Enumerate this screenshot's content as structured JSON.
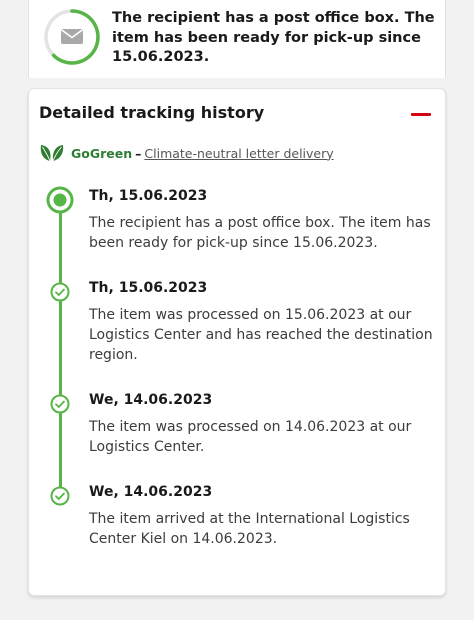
{
  "status": {
    "icon": "envelope-icon",
    "text": "The recipient has a post office box. The item has been ready for pick-up since 15.06.2023."
  },
  "history": {
    "title": "Detailed tracking history",
    "collapse_icon": "minus-icon",
    "gogreen": {
      "name": "GoGreen",
      "dash": "–",
      "link": "Climate-neutral letter delivery",
      "icon": "leaf-icon"
    },
    "events": [
      {
        "date": "Th, 15.06.2023",
        "text": "The recipient has a post office box. The item has been ready for pick-up since 15.06.2023.",
        "state": "current"
      },
      {
        "date": "Th, 15.06.2023",
        "text": "The item was processed on 15.06.2023 at our Logistics Center and has reached the destination region.",
        "state": "done"
      },
      {
        "date": "We, 14.06.2023",
        "text": "The item was processed on 14.06.2023 at our Logistics Center.",
        "state": "done"
      },
      {
        "date": "We, 14.06.2023",
        "text": "The item arrived at the International Logistics Center Kiel on 14.06.2023.",
        "state": "done"
      }
    ]
  },
  "colors": {
    "accent_red": "#d40511",
    "progress_green": "#57b446",
    "gogreen_green": "#2e7d32"
  }
}
